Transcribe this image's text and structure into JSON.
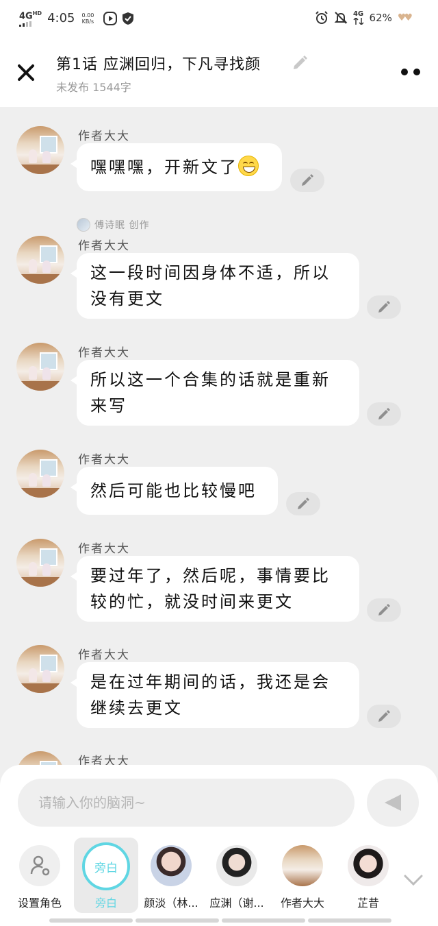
{
  "status_bar": {
    "network": "4G",
    "network_sup": "HD",
    "time": "4:05",
    "speed_value": "0.00",
    "speed_unit": "KB/s",
    "network_right": "4G",
    "battery": "62%",
    "icons": [
      "play-icon",
      "shield-icon",
      "alarm-icon",
      "mute-bell-icon",
      "signal-icon",
      "hearts-icon"
    ]
  },
  "header": {
    "title": "第1话  应渊回归，下凡寻找颜",
    "subtitle": "未发布 1544字",
    "close_icon": "close-icon",
    "edit_icon": "pencil-icon",
    "more_icon": "more-icon"
  },
  "messages": [
    {
      "author": "作者大大",
      "text": "嘿嘿嘿，开新文了",
      "emoji": "grin-emoji",
      "creator": "傅诗眠 创作"
    },
    {
      "author": "作者大大",
      "text": "这一段时间因身体不适，所以没有更文"
    },
    {
      "author": "作者大大",
      "text": "所以这一个合集的话就是重新来写"
    },
    {
      "author": "作者大大",
      "text": "然后可能也比较慢吧"
    },
    {
      "author": "作者大大",
      "text": "要过年了，然后呢，事情要比较的忙，就没时间来更文"
    },
    {
      "author": "作者大大",
      "text": "是在过年期间的话，我还是会继续去更文"
    },
    {
      "author": "作者大大"
    }
  ],
  "composer": {
    "placeholder": "请输入你的脑洞~",
    "send_icon": "send-icon"
  },
  "roles": [
    {
      "label": "设置角色",
      "icon": "person-settings-icon"
    },
    {
      "label": "旁白",
      "avatar_text": "旁白",
      "selected": true
    },
    {
      "label": "颜淡（林..."
    },
    {
      "label": "应渊（谢..."
    },
    {
      "label": "作者大大"
    },
    {
      "label": "芷昔"
    }
  ],
  "colors": {
    "accent": "#5fd6e3",
    "background": "#efefef",
    "bubble": "#ffffff",
    "muted_text": "#999999"
  }
}
